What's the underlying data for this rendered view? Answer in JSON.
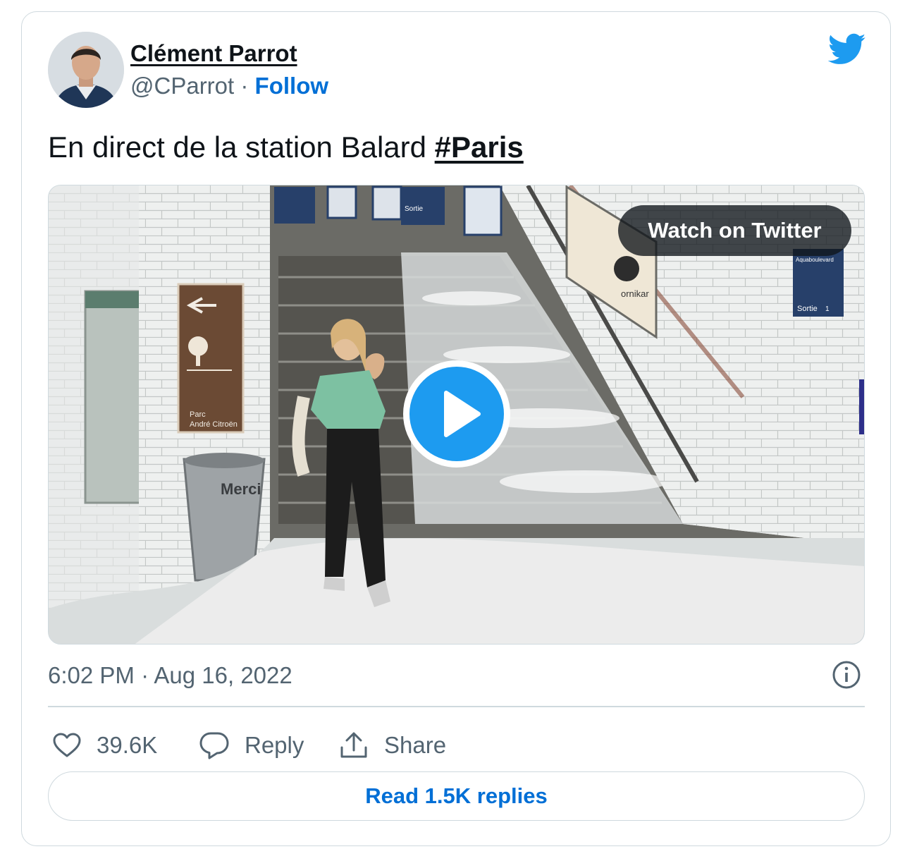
{
  "author": {
    "name": "Clément Parrot",
    "handle": "@CParrot",
    "separator": "·",
    "follow_label": "Follow"
  },
  "tweet": {
    "text": "En direct de la station Balard ",
    "hashtag": "#Paris"
  },
  "media": {
    "watch_label": "Watch on Twitter",
    "signs": {
      "park_line1": "Parc",
      "park_line2": "André Citroën",
      "bin_label": "Merci",
      "exit_panel_title": "Aquaboulevard",
      "exit_panel_sortie": "Sortie",
      "exit_panel_number": "1",
      "top_sign_sortie": "Sortie",
      "poster_brand": "ornikar"
    }
  },
  "timestamp": "6:02 PM · Aug 16, 2022",
  "actions": {
    "likes_count": "39.6K",
    "reply_label": "Reply",
    "share_label": "Share"
  },
  "read_replies_label": "Read 1.5K replies",
  "colors": {
    "twitter_blue": "#1d9bf0",
    "link_blue": "#006fd6",
    "secondary_text": "#536471",
    "border": "#cfd9de"
  },
  "icons": [
    "twitter-bird-icon",
    "play-icon",
    "info-icon",
    "heart-icon",
    "reply-bubble-icon",
    "share-icon"
  ]
}
